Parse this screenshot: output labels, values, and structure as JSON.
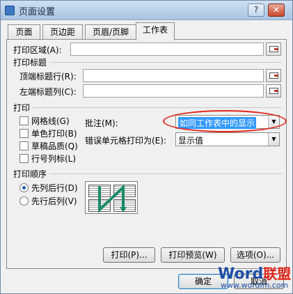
{
  "window": {
    "title": "页面设置",
    "help_button": "?",
    "close_button": "✕"
  },
  "tabs": [
    {
      "label": "页面"
    },
    {
      "label": "页边距"
    },
    {
      "label": "页眉/页脚"
    },
    {
      "label": "工作表",
      "active": true
    }
  ],
  "print_area": {
    "label": "打印区域(A):",
    "value": ""
  },
  "print_titles": {
    "section_label": "打印标题",
    "rows_label": "顶端标题行(R):",
    "rows_value": "",
    "cols_label": "左端标题列(C):",
    "cols_value": ""
  },
  "print": {
    "section_label": "打印",
    "gridlines": {
      "label": "网格线(G)",
      "checked": false
    },
    "black_white": {
      "label": "单色打印(B)",
      "checked": false
    },
    "draft": {
      "label": "草稿品质(Q)",
      "checked": false
    },
    "headings": {
      "label": "行号列标(L)",
      "checked": false
    },
    "comments_label": "批注(M):",
    "comments_value": "如同工作表中的显示",
    "errors_label": "错误单元格打印为(E):",
    "errors_value": "显示值"
  },
  "page_order": {
    "section_label": "打印顺序",
    "down_then_over": {
      "label": "先列后行(D)",
      "selected": true
    },
    "over_then_down": {
      "label": "先行后列(V)",
      "selected": false
    }
  },
  "buttons": {
    "print": "打印(P)...",
    "preview": "打印预览(W)",
    "options": "选项(O)...",
    "ok": "确定",
    "cancel": "取消"
  },
  "watermark": {
    "word": "Word",
    "cn": "联盟",
    "url": "www.wordlm.com"
  },
  "colors": {
    "highlight": "#3399ff",
    "annotation": "#e0261b",
    "watermark_blue": "#1f4fa6"
  }
}
